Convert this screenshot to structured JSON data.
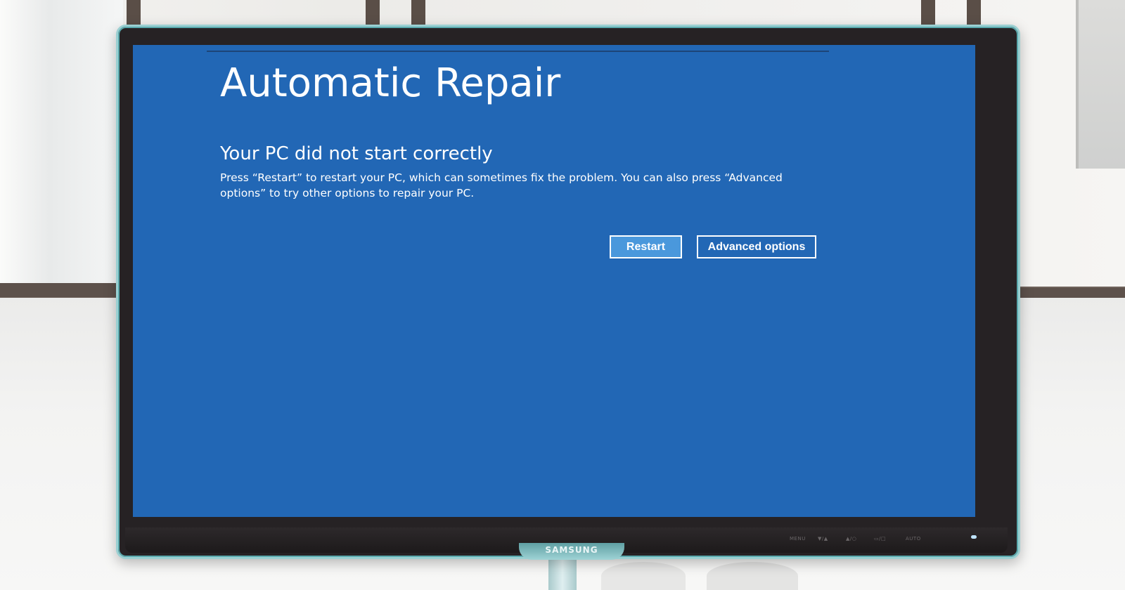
{
  "screen": {
    "title": "Automatic Repair",
    "subtitle": "Your PC did not start correctly",
    "message": "Press “Restart” to restart your PC, which can sometimes fix the problem. You can also press “Advanced options” to try other options to repair your PC.",
    "buttons": {
      "restart_label": "Restart",
      "advanced_label": "Advanced options"
    },
    "colors": {
      "background": "#2267b5",
      "restart_button": "#4a98dc",
      "text": "#ffffff"
    }
  },
  "monitor": {
    "brand": "SAMSUNG",
    "controls": [
      "MENU",
      "▼/▲",
      "▲/○",
      "▭/□",
      "AUTO"
    ]
  }
}
